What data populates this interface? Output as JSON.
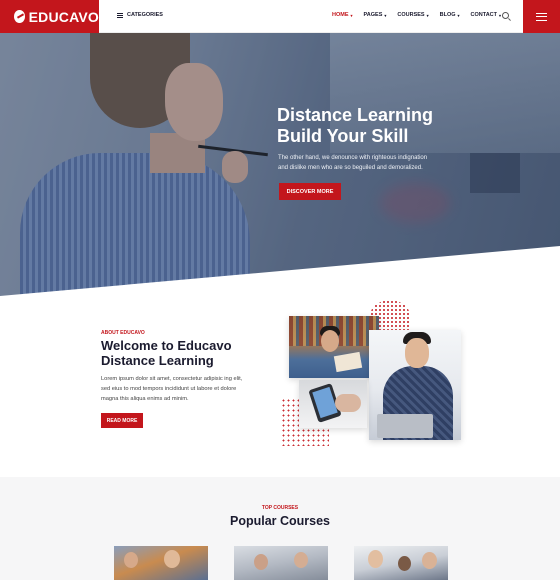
{
  "brand": {
    "name": "EDUCAVO",
    "accent": "#c3161c"
  },
  "header": {
    "categories_label": "CATEGORIES",
    "nav": [
      {
        "label": "HOME",
        "active": true
      },
      {
        "label": "PAGES",
        "active": false
      },
      {
        "label": "COURSES",
        "active": false
      },
      {
        "label": "BLOG",
        "active": false
      },
      {
        "label": "CONTACT",
        "active": false
      }
    ],
    "icons": [
      "grid-icon",
      "search-icon",
      "hamburger-menu-icon"
    ]
  },
  "hero": {
    "title_line1": "Distance Learning",
    "title_line2": "Build Your Skill",
    "description": "The other hand, we denounce with righteous indignation and dislike men who are so beguiled and demoralized.",
    "button_label": "DISCOVER MORE"
  },
  "about": {
    "label": "ABOUT EDUCAVO",
    "title_line1": "Welcome to Educavo",
    "title_line2": "Distance Learning",
    "description": "Lorem ipsum dolor sit amet, consectetur adipisic ing elit, sed eius to mod tempors incididunt ut labore et dolore magna this aliqua enims ad minim.",
    "button_label": "READ MORE"
  },
  "courses": {
    "label": "TOP COURSES",
    "title": "Popular Courses"
  }
}
